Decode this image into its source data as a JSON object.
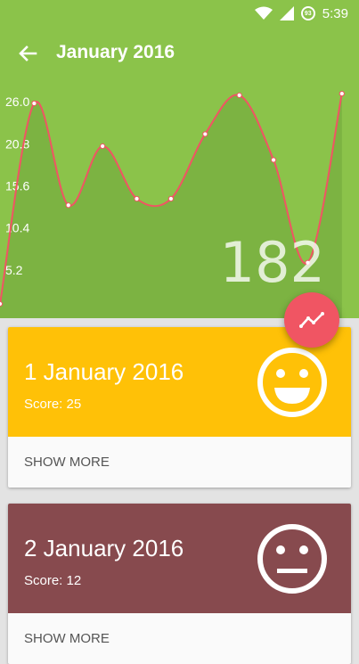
{
  "status_bar": {
    "time": "5:39",
    "battery": "93",
    "icons": [
      "wifi-icon",
      "signal-icon",
      "battery-icon"
    ]
  },
  "app_bar": {
    "back_icon": "arrow-back-icon",
    "title": "January 2016"
  },
  "colors": {
    "primary": "#8bc34a",
    "chart_fill": "#7cb342",
    "line": "#f05563",
    "fab": "#f05563",
    "good_day": "#ffc107",
    "bad_day": "#874a4e"
  },
  "chart_data": {
    "type": "area",
    "y_ticks": [
      "26.0",
      "20.8",
      "15.6",
      "10.4",
      "5.2"
    ],
    "ylim": [
      0,
      28
    ],
    "xlim": [
      0,
      21
    ],
    "points": [
      {
        "x": 0,
        "y": 1.0
      },
      {
        "x": 2,
        "y": 25.8
      },
      {
        "x": 4,
        "y": 13.2
      },
      {
        "x": 6,
        "y": 20.5
      },
      {
        "x": 8,
        "y": 14.0
      },
      {
        "x": 10,
        "y": 14.0
      },
      {
        "x": 12,
        "y": 22.0
      },
      {
        "x": 14,
        "y": 26.8
      },
      {
        "x": 16,
        "y": 18.8
      },
      {
        "x": 18,
        "y": 6.1
      },
      {
        "x": 20,
        "y": 27.0
      }
    ],
    "highlight_value": "182"
  },
  "fab": {
    "icon": "trending-line-icon"
  },
  "cards": [
    {
      "date": "1 January 2016",
      "score": "Score: 25",
      "mood_icon": "smiley-happy-icon",
      "color": "#ffc107",
      "action": "SHOW MORE"
    },
    {
      "date": "2 January 2016",
      "score": "Score: 12",
      "mood_icon": "smiley-neutral-icon",
      "color": "#874a4e",
      "action": "SHOW MORE"
    }
  ]
}
